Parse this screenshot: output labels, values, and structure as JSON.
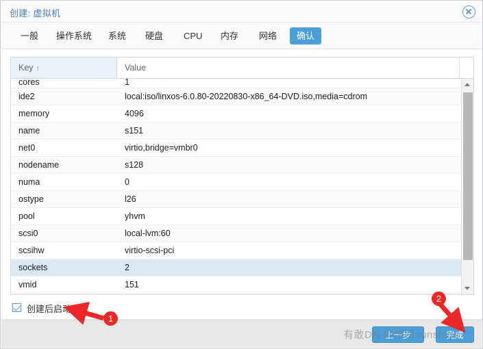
{
  "window": {
    "title": "创建: 虚拟机",
    "close_icon": "close-circle-icon"
  },
  "tabs": [
    {
      "label": "一般",
      "active": false
    },
    {
      "label": "操作系统",
      "active": false
    },
    {
      "label": "系统",
      "active": false
    },
    {
      "label": "硬盘",
      "active": false
    },
    {
      "label": "CPU",
      "active": false
    },
    {
      "label": "内存",
      "active": false
    },
    {
      "label": "网络",
      "active": false
    },
    {
      "label": "确认",
      "active": true
    }
  ],
  "table": {
    "columns": {
      "key": "Key",
      "value": "Value",
      "sort_indicator": "↑"
    },
    "rows": [
      {
        "key": "cores",
        "value": "1"
      },
      {
        "key": "ide2",
        "value": "local:iso/linxos-6.0.80-20220830-x86_64-DVD.iso,media=cdrom"
      },
      {
        "key": "memory",
        "value": "4096"
      },
      {
        "key": "name",
        "value": "s151"
      },
      {
        "key": "net0",
        "value": "virtio,bridge=vmbr0"
      },
      {
        "key": "nodename",
        "value": "s128"
      },
      {
        "key": "numa",
        "value": "0"
      },
      {
        "key": "ostype",
        "value": "l26"
      },
      {
        "key": "pool",
        "value": "yhvm"
      },
      {
        "key": "scsi0",
        "value": "local-lvm:60"
      },
      {
        "key": "scsihw",
        "value": "virtio-scsi-pci"
      },
      {
        "key": "sockets",
        "value": "2"
      },
      {
        "key": "vmid",
        "value": "151"
      }
    ],
    "selected_key": "sockets",
    "scrollbar": {
      "up_icon": "caret-up-icon",
      "down_icon": "caret-down-icon"
    }
  },
  "options": {
    "start_after_create_label": "创建后启动",
    "start_after_create_checked": true
  },
  "footer": {
    "back_label": "上一步",
    "finish_label": "完成"
  },
  "watermark": {
    "text": "有敢DN @恒悦sunshine"
  },
  "annotations": [
    {
      "badge": "1",
      "target": "创建后启动"
    },
    {
      "badge": "2",
      "target": "完成"
    }
  ],
  "colors": {
    "accent": "#4a9fd8",
    "title_text": "#4b7fb5",
    "selected_row": "#dbe9f5",
    "header_key_bg": "#eaf2fa",
    "annotation_red": "#ec2727",
    "footer_bg": "#e8e8e8"
  }
}
